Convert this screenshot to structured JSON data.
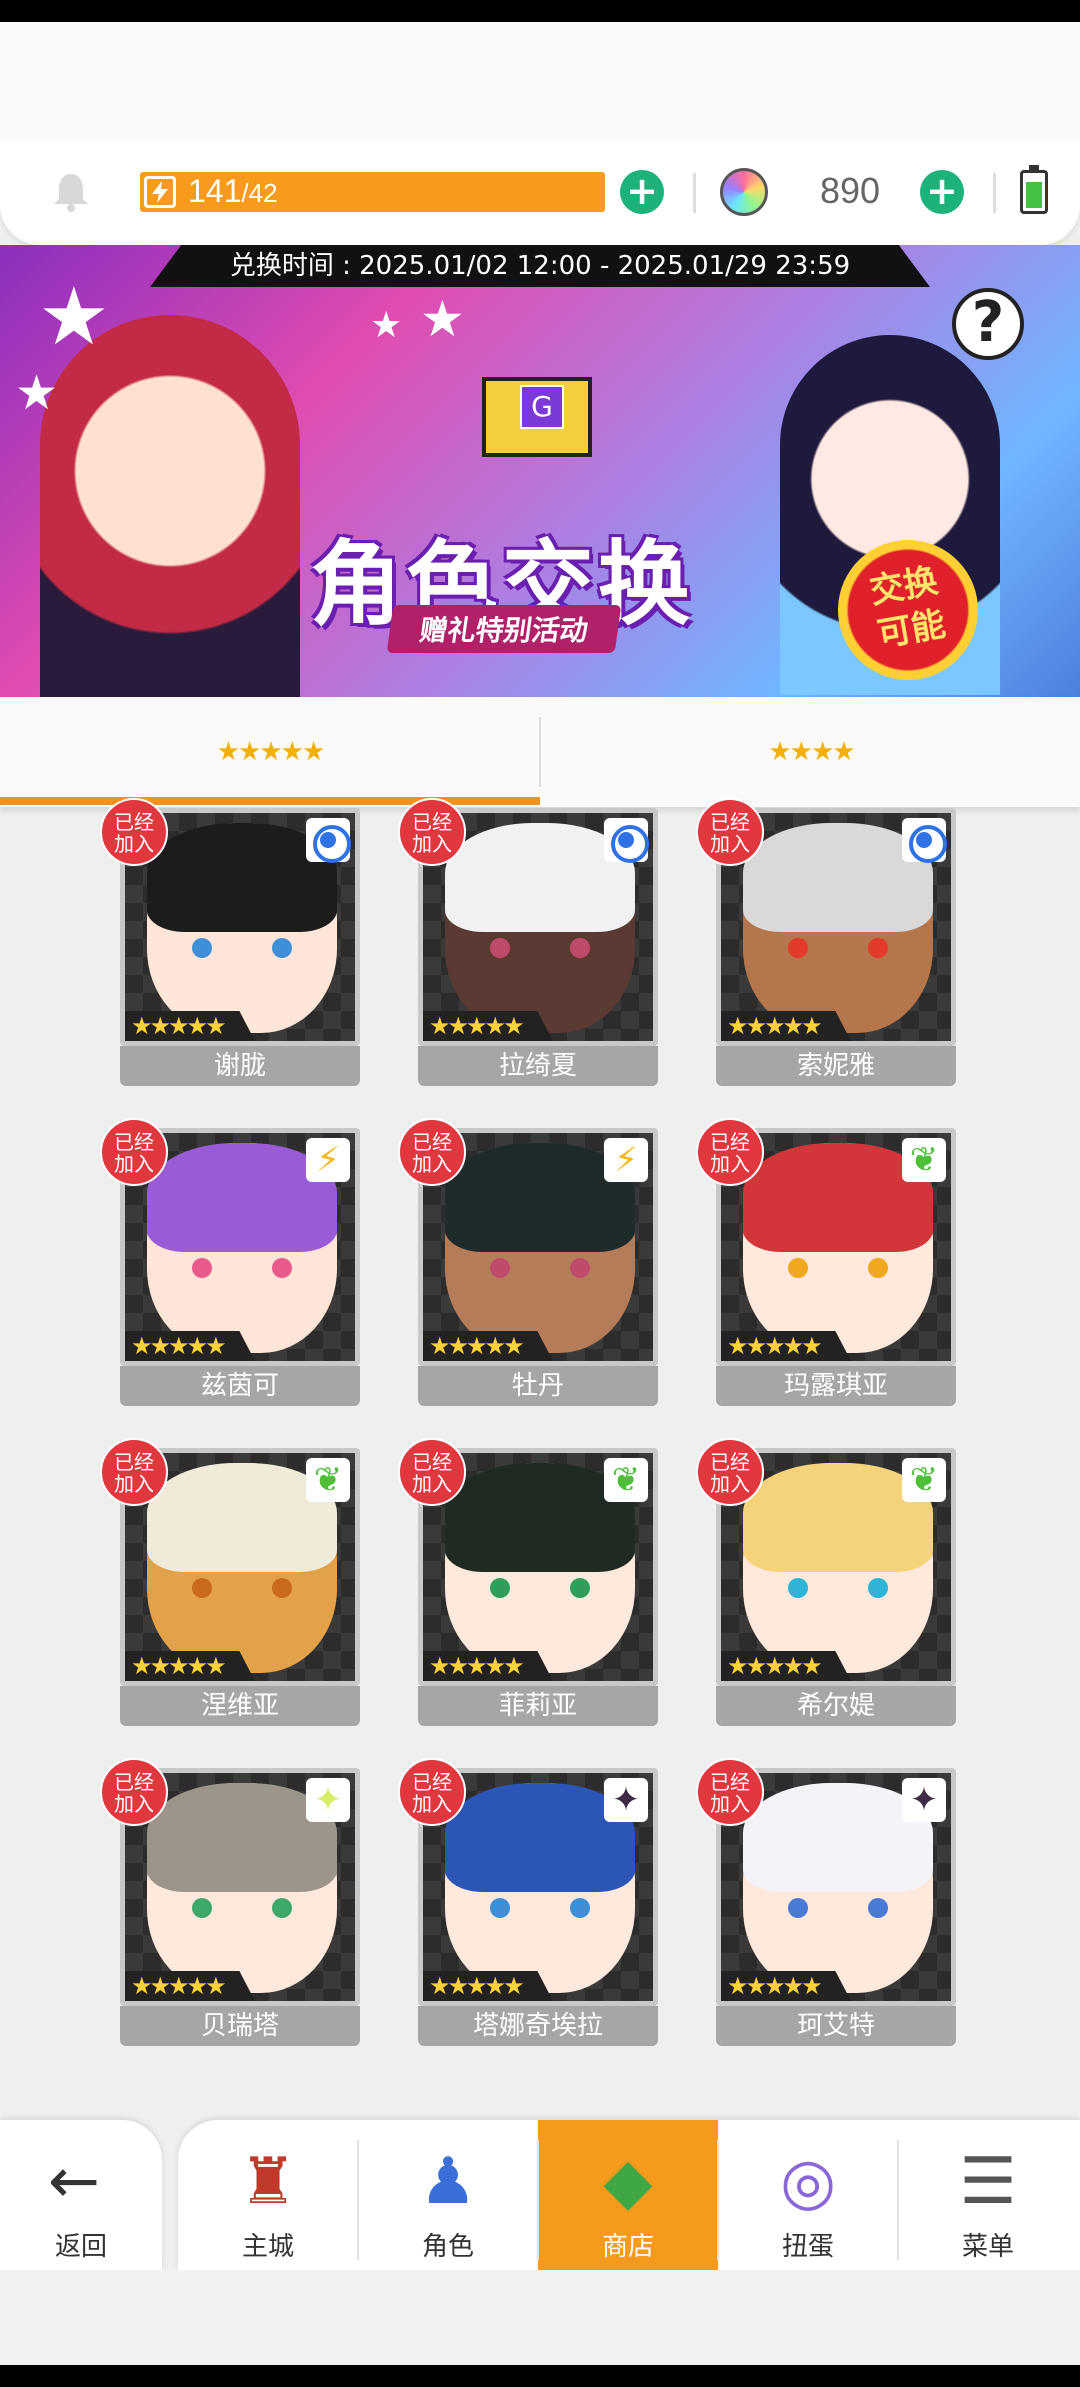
{
  "header": {
    "bell_icon": "bell-icon",
    "stamina_current": "141",
    "stamina_max": "/42",
    "gem_count": "890",
    "plus_label": "+"
  },
  "banner": {
    "time_text": "兑换时间 : 2025.01/02 12:00 - 2025.01/29 23:59",
    "title": "角色交换",
    "subtitle": "赠礼特别活动",
    "badge": "交换可能",
    "help": "?",
    "envelope_letter": "G"
  },
  "tabs": [
    {
      "label": "★★★★★"
    },
    {
      "label": "★★★★"
    }
  ],
  "characters": [
    {
      "name": "谢胧",
      "badge": "已经加入",
      "stars": "★★★★★",
      "element": "water",
      "hair": "#1c1c1c",
      "skin": "#ffe6d8",
      "eye": "#3f8fd8"
    },
    {
      "name": "拉绮夏",
      "badge": "已经加入",
      "stars": "★★★★★",
      "element": "water",
      "hair": "#f1f1f1",
      "skin": "#5a3a33",
      "eye": "#c04a6a"
    },
    {
      "name": "索妮雅",
      "badge": "已经加入",
      "stars": "★★★★★",
      "element": "water",
      "hair": "#d9d9d9",
      "skin": "#b6764b",
      "eye": "#e33a2a"
    },
    {
      "name": "兹茵可",
      "badge": "已经加入",
      "stars": "★★★★★",
      "element": "bolt",
      "hair": "#9a5bd6",
      "skin": "#ffe4d8",
      "eye": "#e85a8a"
    },
    {
      "name": "牡丹",
      "badge": "已经加入",
      "stars": "★★★★★",
      "element": "bolt",
      "hair": "#1f2b2b",
      "skin": "#b57c5a",
      "eye": "#c04a6a"
    },
    {
      "name": "玛露琪亚",
      "badge": "已经加入",
      "stars": "★★★★★",
      "element": "leaf",
      "hair": "#d2353a",
      "skin": "#ffe8dc",
      "eye": "#f0a91e"
    },
    {
      "name": "涅维亚",
      "badge": "已经加入",
      "stars": "★★★★★",
      "element": "leaf",
      "hair": "#f0ead8",
      "skin": "#e3a24a",
      "eye": "#c96a1c"
    },
    {
      "name": "菲莉亚",
      "badge": "已经加入",
      "stars": "★★★★★",
      "element": "leaf",
      "hair": "#1f2a22",
      "skin": "#ffe8dc",
      "eye": "#2f9e5a"
    },
    {
      "name": "希尔媞",
      "badge": "已经加入",
      "stars": "★★★★★",
      "element": "leaf",
      "hair": "#f4d37a",
      "skin": "#ffe8dc",
      "eye": "#2fb4d8"
    },
    {
      "name": "贝瑞塔",
      "badge": "已经加入",
      "stars": "★★★★★",
      "element": "light",
      "hair": "#9b958a",
      "skin": "#ffe8dc",
      "eye": "#3ea86a"
    },
    {
      "name": "塔娜奇埃拉",
      "badge": "已经加入",
      "stars": "★★★★★",
      "element": "dark",
      "hair": "#2b56b8",
      "skin": "#ffe8dc",
      "eye": "#3f8fd8"
    },
    {
      "name": "珂艾特",
      "badge": "已经加入",
      "stars": "★★★★★",
      "element": "dark",
      "hair": "#f4f4f8",
      "skin": "#ffe8dc",
      "eye": "#4a7ad8"
    }
  ],
  "nav": {
    "back_label": "返回",
    "items": [
      {
        "label": "主城",
        "icon": "castle-icon",
        "glyph": "♜"
      },
      {
        "label": "角色",
        "icon": "character-icon",
        "glyph": "♟"
      },
      {
        "label": "商店",
        "icon": "shop-icon",
        "glyph": "◆"
      },
      {
        "label": "扭蛋",
        "icon": "gacha-icon",
        "glyph": "◎"
      },
      {
        "label": "菜单",
        "icon": "menu-icon",
        "glyph": "☰"
      }
    ],
    "active_index": 2
  },
  "colors": {
    "accent": "#f69a1d",
    "badge_red": "#e0383e",
    "plus_green": "#1db27a"
  }
}
